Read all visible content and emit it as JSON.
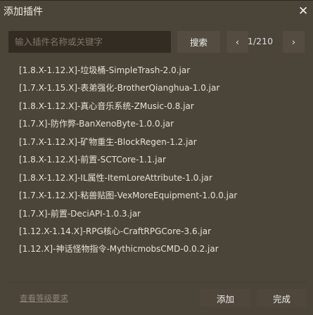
{
  "dialog": {
    "title": "添加插件",
    "close_icon": "close-icon"
  },
  "search": {
    "placeholder": "输入插件名称或关键字",
    "value": "",
    "button": "搜索"
  },
  "pagination": {
    "text": "1/210",
    "current": 1,
    "total": 210
  },
  "plugins": [
    "[1.8.X-1.12.X]-垃圾桶-SimpleTrash-2.0.jar",
    "[1.7.X-1.15.X]-表弟强化-BrotherQianghua-1.0.jar",
    "[1.8.X-1.12.X]-真心音乐系统-ZMusic-0.8.jar",
    "[1.7.X]-防作弊-BanXenoByte-1.0.0.jar",
    "[1.7.X-1.12.X]-矿物重生-BlockRegen-1.2.jar",
    "[1.8.X-1.12.X]-前置-SCTCore-1.1.jar",
    "[1.8.X-1.12.X]-IL属性-ItemLoreAttribute-1.0.jar",
    "[1.7.X-1.12.X]-粘兽贴图-VexMoreEquipment-1.0.0.jar",
    "[1.7.X]-前置-DeciAPI-1.0.3.jar",
    "[1.12.X-1.14.X]-RPG核心-CraftRPGCore-3.6.jar",
    "[1.12.X]-神话怪物指令-MythicmobsCMD-0.0.2.jar"
  ],
  "footer": {
    "level_link": "查看等级要求",
    "add": "添加",
    "done": "完成"
  }
}
